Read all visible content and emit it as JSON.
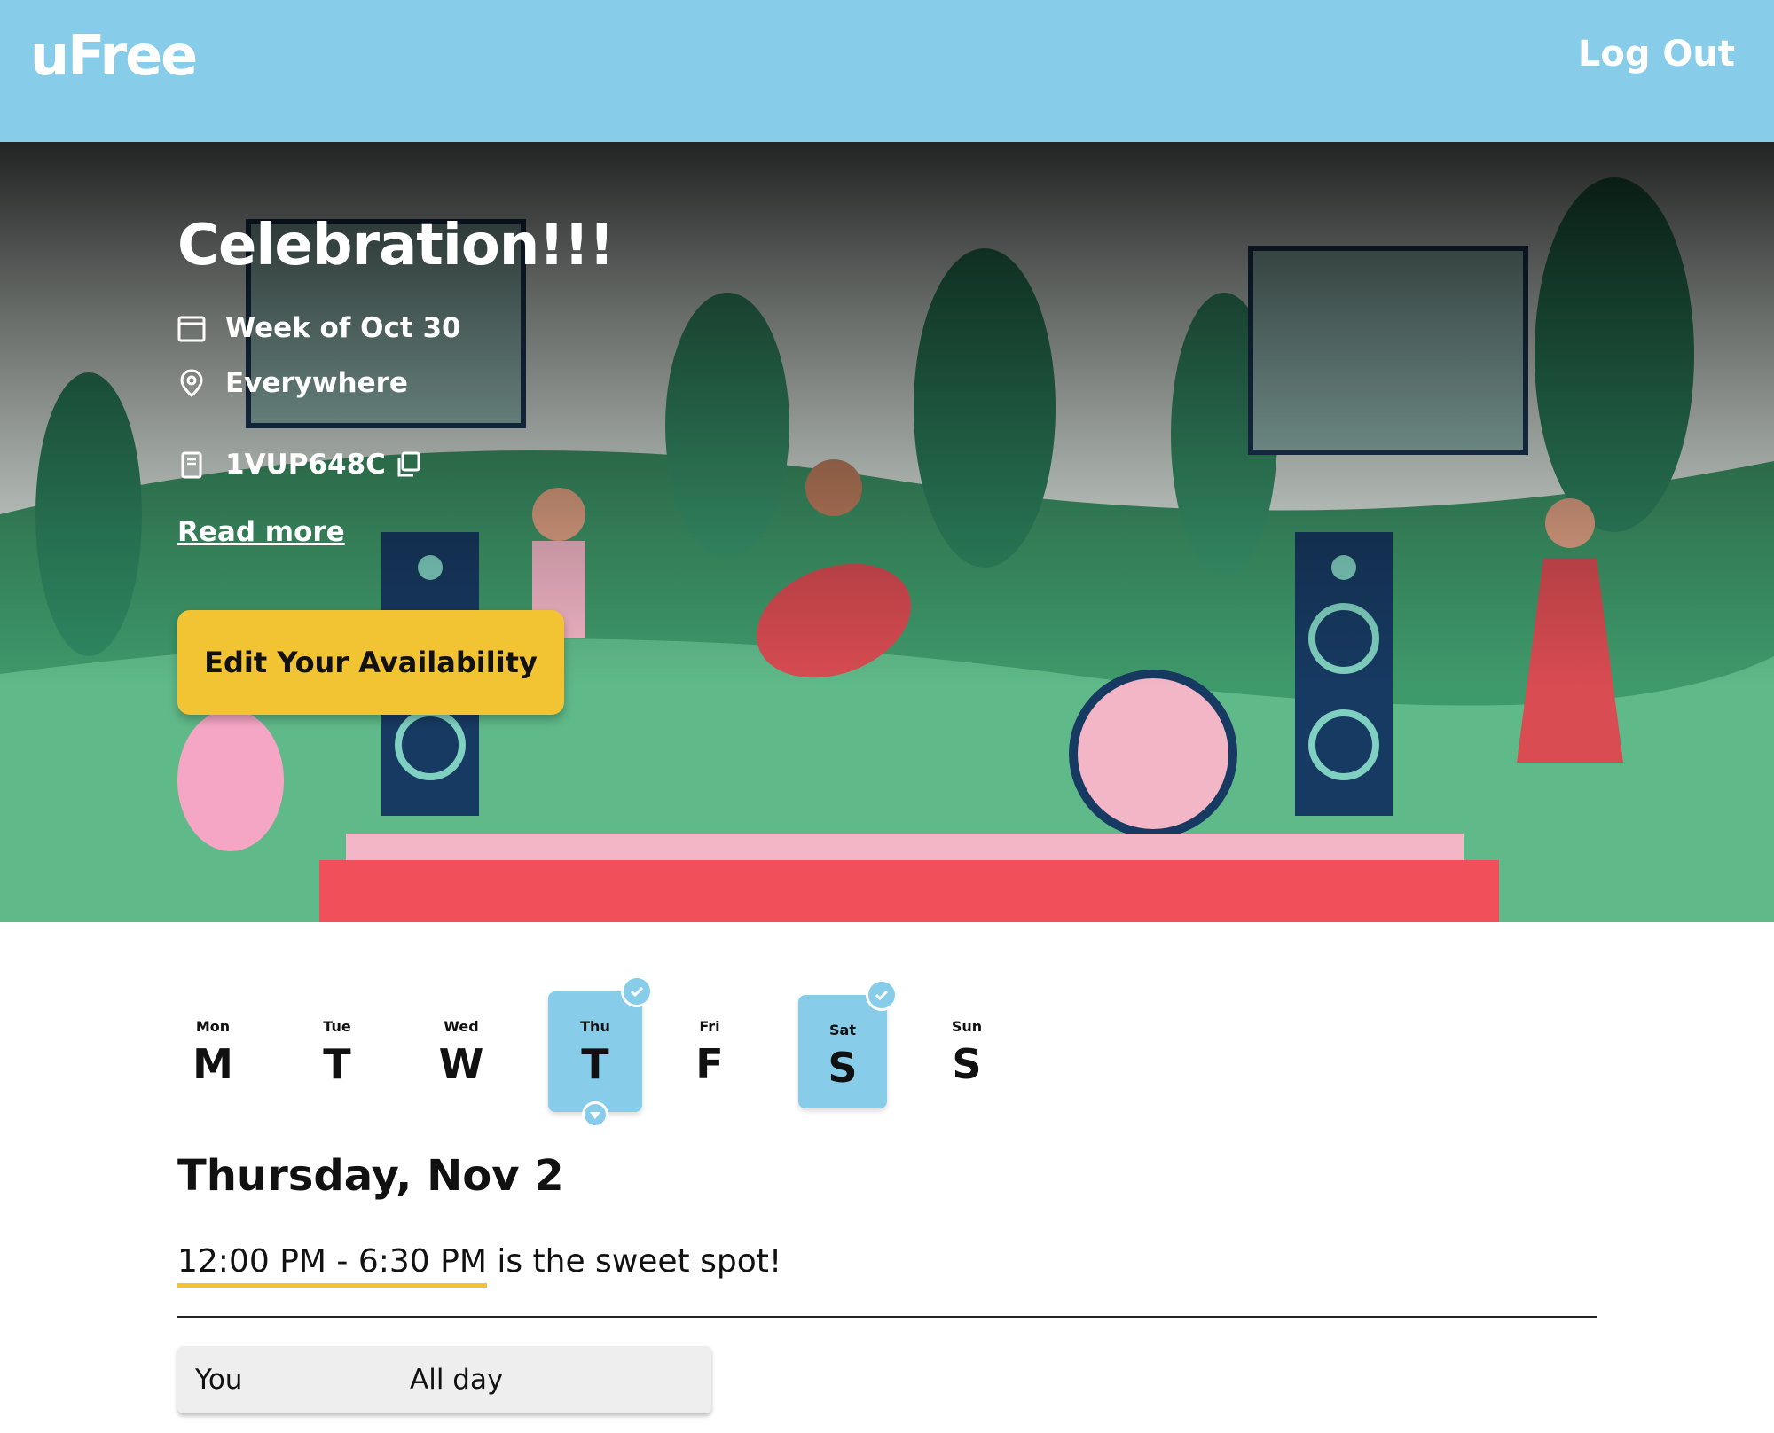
{
  "app": {
    "brand": "uFree",
    "logout_label": "Log Out"
  },
  "event": {
    "title": "Celebration!!!",
    "week": "Week of Oct 30",
    "location": "Everywhere",
    "code": "1VUP648C",
    "read_more": "Read more",
    "edit_label": "Edit Your Availability"
  },
  "days": [
    {
      "abbr": "Mon",
      "letter": "M"
    },
    {
      "abbr": "Tue",
      "letter": "T"
    },
    {
      "abbr": "Wed",
      "letter": "W"
    },
    {
      "abbr": "Thu",
      "letter": "T"
    },
    {
      "abbr": "Fri",
      "letter": "F"
    },
    {
      "abbr": "Sat",
      "letter": "S"
    },
    {
      "abbr": "Sun",
      "letter": "S"
    }
  ],
  "selected_day": {
    "heading": "Thursday, Nov 2",
    "sweet_range": "12:00 PM - 6:30 PM",
    "sweet_suffix": " is the sweet spot!"
  },
  "availability": [
    {
      "who": "You",
      "when": "All day"
    }
  ],
  "colors": {
    "nav": "#87cdea",
    "accent": "#f2c332",
    "selected": "#87cdea"
  }
}
